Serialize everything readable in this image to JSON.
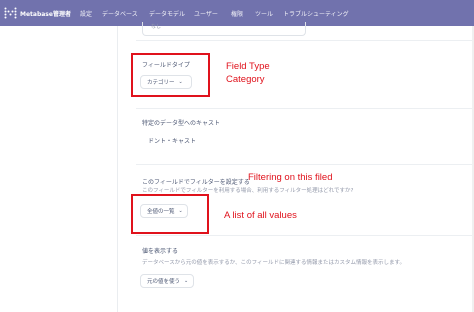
{
  "navbar": {
    "brand": "Metabase管理者",
    "items": [
      "設定",
      "データベース",
      "データモデル",
      "ユーザー",
      "権限",
      "ツール",
      "トラブルシューティング"
    ],
    "colors": {
      "bar": "#7172ad",
      "text": "#ffffff"
    }
  },
  "top_field": {
    "value": "なし"
  },
  "field_type": {
    "label": "フィールドタイプ",
    "value": "カテゴリー"
  },
  "cast": {
    "label": "特定のデータ型へのキャスト",
    "value": "ドント・キャスト"
  },
  "filtering": {
    "label": "このフィールドでフィルターを設定する",
    "description": "このフィールドでフィルターを利用する場合、利用するフィルター処理はどれですか?",
    "value": "全値の一覧"
  },
  "display_values": {
    "label": "値を表示する",
    "description": "データベースから元の値を表示するか、このフィールドに関連する情報またはカスタム情報を表示します。",
    "value": "元の値を使う"
  },
  "annotations": {
    "field_type_line1": "Field Type",
    "field_type_line2": "Category",
    "filtering": "Filtering on this filed",
    "list_values": "A list of all values",
    "color": "#e0121c"
  },
  "icons": [
    "metabase-logo-icon",
    "chevron-down-icon"
  ]
}
